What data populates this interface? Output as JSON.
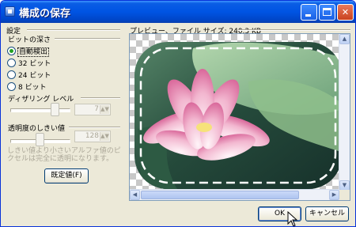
{
  "window": {
    "title": "構成の保存",
    "controls": {
      "minimize": "minimize",
      "maximize": "maximize",
      "close": "close"
    }
  },
  "settings": {
    "section_label": "設定",
    "bit_depth": {
      "label": "ビットの深さ",
      "options": [
        {
          "label": "自動検出",
          "selected": true
        },
        {
          "label": "32 ビット",
          "selected": false
        },
        {
          "label": "24 ビット",
          "selected": false
        },
        {
          "label": "8 ビット",
          "selected": false
        }
      ]
    },
    "dithering": {
      "label": "ディザリング レベル",
      "value": "7",
      "level": 0.5
    },
    "transparency": {
      "label": "透明度のしきい値",
      "value": "128",
      "level": 0.5,
      "note": "しきい値より小さいアルファ値のピクセルは完全に透明になります。"
    },
    "defaults_button": "既定値(F)"
  },
  "preview": {
    "label": "プレビュー、ファイル サイズ: 240.3 KB"
  },
  "buttons": {
    "ok": "OK",
    "cancel": "キャンセル"
  },
  "colors": {
    "titlebar": "#0054e3",
    "close": "#c9411e",
    "radio_selected": "#21a121",
    "dialog_bg": "#ece9d8"
  }
}
